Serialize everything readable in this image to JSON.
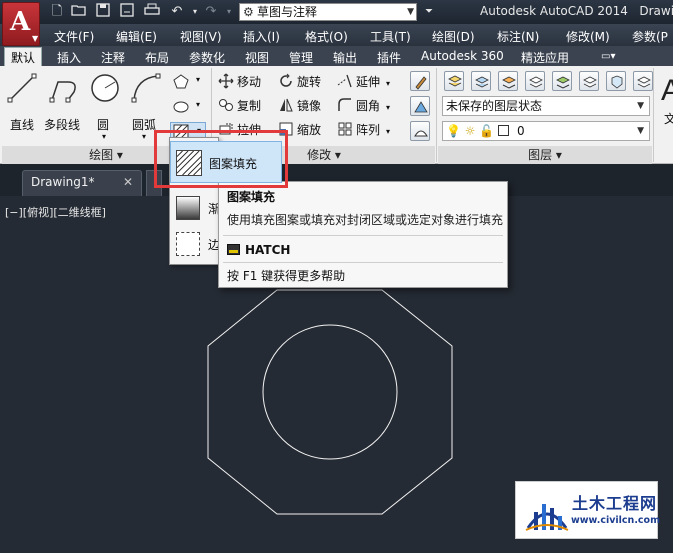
{
  "titlebar": {
    "workspace": "草图与注释",
    "title": "Autodesk AutoCAD 2014",
    "title_cut": "Drawi"
  },
  "menubar": {
    "items": [
      "文件(F)",
      "编辑(E)",
      "视图(V)",
      "插入(I)",
      "格式(O)",
      "工具(T)",
      "绘图(D)",
      "标注(N)",
      "修改(M)",
      "参数(P"
    ]
  },
  "ribbon": {
    "tabs": [
      "默认",
      "插入",
      "注释",
      "布局",
      "参数化",
      "视图",
      "管理",
      "输出",
      "插件",
      "Autodesk 360",
      "精选应用"
    ],
    "draw": {
      "panel_label": "绘图 ▾",
      "line": "直线",
      "polyline": "多段线",
      "circle": "圆",
      "arc": "圆弧"
    },
    "modify": {
      "panel_label": "修改 ▾",
      "move": "移动",
      "rotate": "旋转",
      "extend": "延伸",
      "copy": "复制",
      "mirror": "镜像",
      "fillet": "圆角",
      "stretch": "拉伸",
      "scale": "缩放",
      "array": "阵列"
    },
    "layers": {
      "panel_label": "图层 ▾",
      "state": "未保存的图层状态",
      "current": "0"
    },
    "text_cut": "文"
  },
  "doc": {
    "tab": "Drawing1*",
    "close": "✕",
    "view_label": "[−][俯视][二维线框]"
  },
  "flyout": {
    "hatch": "图案填充",
    "gradient": "渐",
    "boundary": "边"
  },
  "tooltip": {
    "title": "图案填充",
    "desc": "使用填充图案或填充对封闭区域或选定对象进行填充",
    "command": "HATCH",
    "help": "按 F1 键获得更多帮助"
  },
  "watermark": {
    "name": "土木工程网",
    "url": "www.civilcn.com"
  }
}
